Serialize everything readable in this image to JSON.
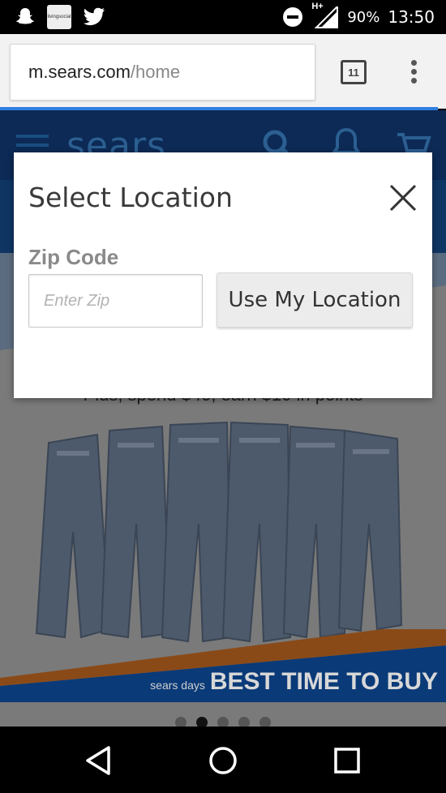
{
  "status_bar": {
    "battery": "90%",
    "time": "13:50",
    "network": "H+",
    "notif_app_label": "livingsocial"
  },
  "browser": {
    "url_host": "m.sears.com",
    "url_path": "/home",
    "tab_count": "11"
  },
  "page": {
    "logo": "sears",
    "promo_text": "Plus, spend $40, earn $10 in points",
    "banner_sub": "sears days",
    "banner_main": "BEST TIME TO BUY"
  },
  "modal": {
    "title": "Select Location",
    "zip_label": "Zip Code",
    "zip_placeholder": "Enter Zip",
    "zip_value": "",
    "location_button": "Use My Location"
  },
  "colors": {
    "header_navy": "#0c2a55",
    "progress_blue": "#2f7fe0",
    "banner_orange": "#a85a1c",
    "banner_blue": "#0a4a9a"
  },
  "icons": [
    "snapchat-icon",
    "twitter-icon",
    "dnd-icon",
    "signal-icon",
    "hamburger-icon",
    "search-icon",
    "bell-icon",
    "cart-icon",
    "close-icon",
    "back-icon",
    "home-icon",
    "recents-icon"
  ]
}
